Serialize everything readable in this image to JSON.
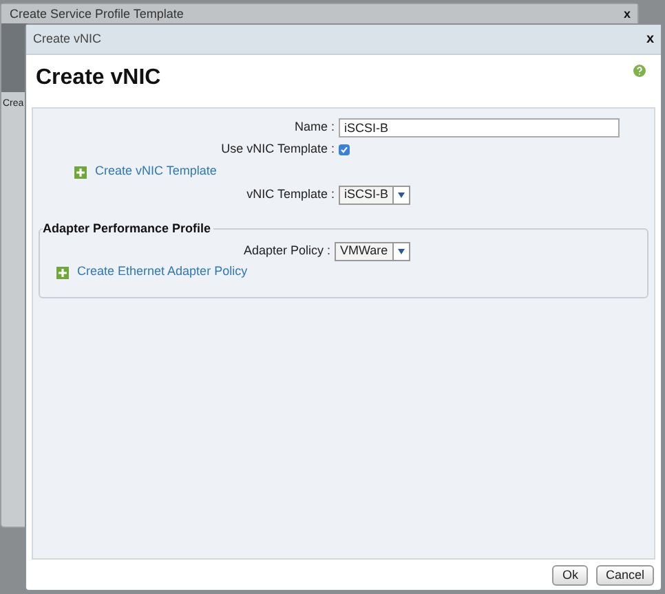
{
  "background_window": {
    "title": "Create Service Profile Template",
    "close": "x",
    "peek_text": "Crea"
  },
  "dialog": {
    "title": "Create vNIC",
    "close": "x",
    "heading": "Create vNIC",
    "name_field": {
      "label": "Name :",
      "value": "iSCSI-B"
    },
    "use_template": {
      "label": "Use vNIC Template :",
      "checked": true
    },
    "create_template_link": "Create vNIC Template",
    "template_select": {
      "label": "vNIC Template :",
      "value": "iSCSI-B"
    },
    "adapter_section": {
      "title": "Adapter Performance Profile",
      "policy_select": {
        "label": "Adapter Policy :",
        "value": "VMWare"
      },
      "create_policy_link": "Create Ethernet Adapter Policy"
    },
    "buttons": [
      "Ok",
      "Cancel"
    ]
  }
}
